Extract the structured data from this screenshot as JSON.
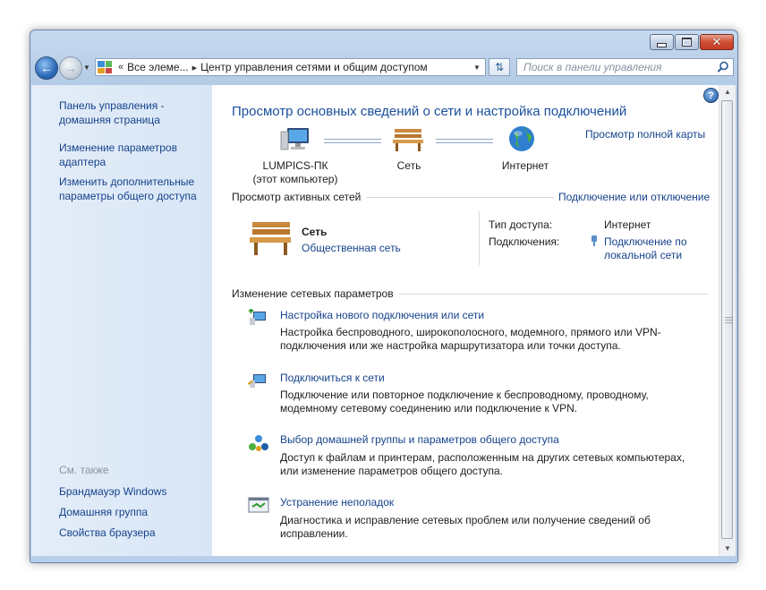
{
  "window": {
    "controls": {
      "minimize": "minimize",
      "maximize": "maximize",
      "close": "✕"
    }
  },
  "nav": {
    "breadcrumb": [
      {
        "label": "Все элеме..."
      },
      {
        "label": "Центр управления сетями и общим доступом"
      }
    ],
    "breadcrumb_prefix": "«",
    "search_placeholder": "Поиск в панели управления"
  },
  "sidebar": {
    "links": [
      {
        "label": "Панель управления - домашняя страница"
      },
      {
        "label": "Изменение параметров адаптера"
      },
      {
        "label": "Изменить дополнительные параметры общего доступа"
      }
    ],
    "see_also_label": "См. также",
    "see_also": [
      {
        "label": "Брандмауэр Windows"
      },
      {
        "label": "Домашняя группа"
      },
      {
        "label": "Свойства браузера"
      }
    ]
  },
  "main": {
    "title": "Просмотр основных сведений о сети и настройка подключений",
    "full_map_link": "Просмотр полной карты",
    "map": {
      "computer": {
        "name": "LUMPICS-ПК",
        "sub": "(этот компьютер)",
        "icon": "computer-icon"
      },
      "network": {
        "name": "Сеть",
        "icon": "bench-icon"
      },
      "internet": {
        "name": "Интернет",
        "icon": "globe-icon"
      }
    },
    "active_networks": {
      "label": "Просмотр активных сетей",
      "connect_link": "Подключение или отключение",
      "network_name": "Сеть",
      "network_type": "Общественная сеть",
      "access_type_label": "Тип доступа:",
      "access_type_value": "Интернет",
      "connections_label": "Подключения:",
      "connection_value_1": "Подключение по",
      "connection_value_2": "локальной сети"
    },
    "change_settings": {
      "label": "Изменение сетевых параметров",
      "tasks": [
        {
          "title": "Настройка нового подключения или сети",
          "desc": "Настройка беспроводного, широкополосного, модемного, прямого или VPN-подключения или же настройка маршрутизатора или точки доступа.",
          "icon": "new-connection-icon"
        },
        {
          "title": "Подключиться к сети",
          "desc": "Подключение или повторное подключение к беспроводному, проводному, модемному сетевому соединению или подключение к VPN.",
          "icon": "connect-network-icon"
        },
        {
          "title": "Выбор домашней группы и параметров общего доступа",
          "desc": "Доступ к файлам и принтерам, расположенным на других сетевых компьютерах, или изменение параметров общего доступа.",
          "icon": "homegroup-icon"
        },
        {
          "title": "Устранение неполадок",
          "desc": "Диагностика и исправление сетевых проблем или получение сведений об исправлении.",
          "icon": "troubleshoot-icon"
        }
      ]
    }
  },
  "colors": {
    "link": "#15428b",
    "title": "#1a4f9c",
    "sidebar": "#dce8f6"
  }
}
